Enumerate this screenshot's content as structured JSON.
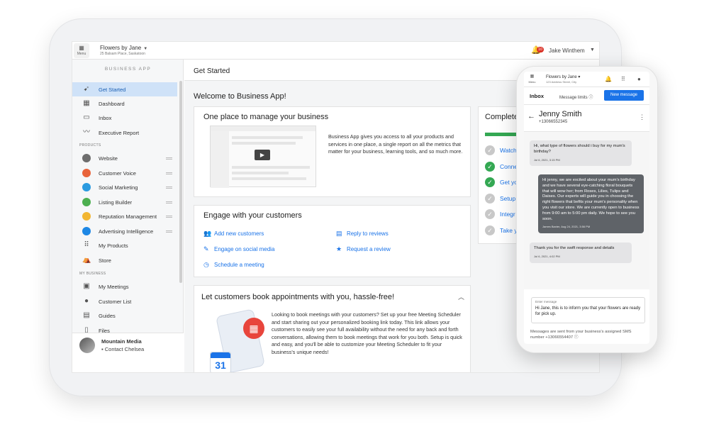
{
  "topbar": {
    "menu_label": "Menu",
    "business_name": "Flowers by Jane",
    "business_address": "25 Balsam Place, Saskatoon",
    "notification_count": "10",
    "user_name": "Jake Winthem"
  },
  "sidebar": {
    "heading": "BUSINESS APP",
    "items_top": [
      {
        "label": "Get Started",
        "icon": "rocket-icon",
        "active": true
      },
      {
        "label": "Dashboard",
        "icon": "dashboard-icon"
      },
      {
        "label": "Inbox",
        "icon": "inbox-icon"
      },
      {
        "label": "Executive Report",
        "icon": "trend-icon"
      }
    ],
    "section_products": "PRODUCTS",
    "products": [
      {
        "label": "Website",
        "color": "#6d6d6d"
      },
      {
        "label": "Customer Voice",
        "color": "#e8643b"
      },
      {
        "label": "Social Marketing",
        "color": "#2b9be0"
      },
      {
        "label": "Listing Builder",
        "color": "#4caf50"
      },
      {
        "label": "Reputation Management",
        "color": "#f2b632"
      },
      {
        "label": "Advertising Intelligence",
        "color": "#1e88e5"
      },
      {
        "label": "My Products",
        "icon": "grid-icon"
      },
      {
        "label": "Store",
        "icon": "basket-icon"
      }
    ],
    "section_business": "MY BUSINESS",
    "business": [
      {
        "label": "My Meetings",
        "icon": "calendar-icon"
      },
      {
        "label": "Customer List",
        "icon": "person-icon"
      },
      {
        "label": "Guides",
        "icon": "guides-icon"
      },
      {
        "label": "Files",
        "icon": "file-icon"
      }
    ],
    "company": "Mountain Media",
    "contact": "Contact Chelsea"
  },
  "main": {
    "page_title": "Get Started",
    "welcome": "Welcome to Business App!",
    "card_manage": {
      "title": "One place to manage your business",
      "body": "Business App gives you access to all your products and services in one place, a single report on all the metrics that matter for your business, learning tools, and so much more."
    },
    "card_engage": {
      "title": "Engage with your customers",
      "links": [
        "Add new customers",
        "Reply to reviews",
        "Engage on social media",
        "Request a review",
        "Schedule a meeting"
      ]
    },
    "card_book": {
      "title": "Let customers book appointments with you, hassle-free!",
      "body": "Looking to book meetings with your customers? Set up your free Meeting Scheduler and start sharing out your personalized booking link today. This link allows your customers to easily see your full availability without the need for any back and forth conversations, allowing them to book meetings that work for you both. Setup is quick and easy, and you'll be able to customize your Meeting Scheduler to fit your business's unique needs!",
      "calendar_day": "31"
    },
    "card_complete": {
      "title": "Complete",
      "progress": 0.3,
      "tasks": [
        {
          "label": "Watch",
          "done": false
        },
        {
          "label": "Conne",
          "done": true
        },
        {
          "label": "Get yo",
          "done": true
        },
        {
          "label": "Setup",
          "done": false
        },
        {
          "label": "Integr",
          "done": false
        },
        {
          "label": "Take y",
          "done": false
        }
      ]
    }
  },
  "phone": {
    "menu_label": "Menu",
    "business_name": "Flowers by Jane",
    "business_address": "123 Address Street, City",
    "inbox_label": "Inbox",
    "limits_label": "Message limits",
    "new_message": "New message",
    "contact_name": "Jenny Smith",
    "contact_phone": "+13066552345",
    "messages": [
      {
        "text": "Hi, what type of flowers should i buy for my mum's birthday?",
        "time": "Jul 6, 2021, 3:15 PM"
      },
      {
        "text": "Hi jenny, we are excited about your mum's birthday and we have several eye-catching floral bouquets that will wow her; from Roses, Lilies, Tulips and Daises. Our experts will guide you in choosing the right flowers that befits your mum's personality when you visit our store. We are currently open to business from 9:00 am to 5:00 pm daily. We hope to see you soon.",
        "time": "James Baxter, Aug 24, 2021, 3:56 PM"
      },
      {
        "text": "Thank you for the swift response and details",
        "time": "Jul 6, 2021, 4:02 PM"
      }
    ],
    "compose_label": "Enter message",
    "compose_value": "Hi Jane, this is to inform you that your flowers are ready for pick up.",
    "footer": "Messages are sent from your business's assigned SMS number +13066554407"
  }
}
